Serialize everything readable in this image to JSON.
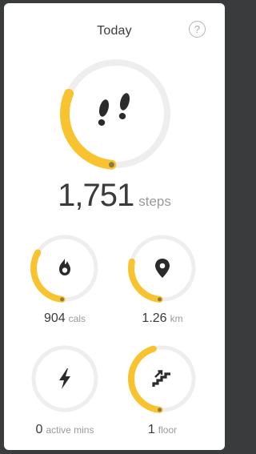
{
  "header": {
    "title": "Today",
    "help_label": "?"
  },
  "steps": {
    "value": "1,751",
    "unit": "steps",
    "progress": 0.3
  },
  "metrics": [
    {
      "key": "calories",
      "value": "904",
      "unit": "cals",
      "progress": 0.32,
      "icon": "flame-icon"
    },
    {
      "key": "distance",
      "value": "1.26",
      "unit": "km",
      "progress": 0.27,
      "icon": "location-pin-icon"
    },
    {
      "key": "active_minutes",
      "value": "0",
      "unit": "active mins",
      "progress": 0,
      "icon": "lightning-bolt-icon"
    },
    {
      "key": "floors",
      "value": "1",
      "unit": "floor",
      "progress": 0.44,
      "icon": "stairs-icon"
    }
  ],
  "colors": {
    "background": "#3a3b3d",
    "card": "#ffffff",
    "ring_track": "#eeeeee",
    "ring_fill": "#f9c330",
    "ring_dot": "#8c7a44"
  }
}
